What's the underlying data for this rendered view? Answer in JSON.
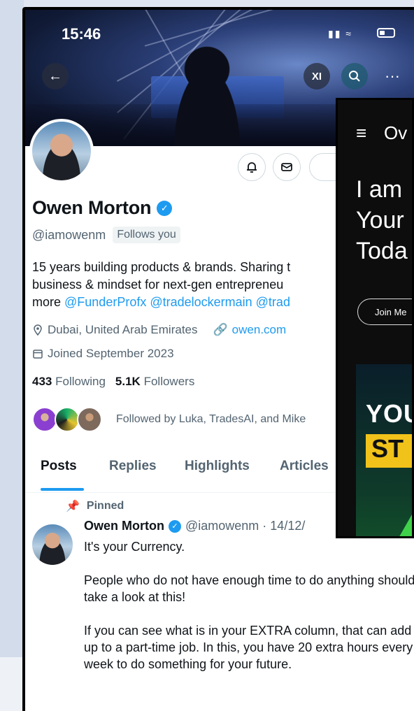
{
  "status_bar": {
    "time": "15:46"
  },
  "header": {
    "back_icon": "arrow-left-icon",
    "grok_label": "XI",
    "search_icon": "search-icon",
    "more_label": "···"
  },
  "profile": {
    "name": "Owen Morton",
    "handle": "@iamowenm",
    "follows_you": "Follows you",
    "bio_line1": "15 years building products & brands. Sharing t",
    "bio_line2": "business & mindset for next-gen entrepreneu",
    "bio_line3_prefix": "more ",
    "bio_mentions": "@FunderProfx @tradelockermain @trad",
    "location": "Dubai, United Arab Emirates",
    "website": "owen.com",
    "joined": "Joined September 2023",
    "following_count": "433",
    "following_label": "Following",
    "followers_count": "5.1K",
    "followers_label": "Followers",
    "followed_by": "Followed by Luka, TradesAI, and Mike"
  },
  "tabs": [
    {
      "label": "Posts",
      "active": true
    },
    {
      "label": "Replies",
      "active": false
    },
    {
      "label": "Highlights",
      "active": false
    },
    {
      "label": "Articles",
      "active": false
    }
  ],
  "post": {
    "pinned_label": "Pinned",
    "author": "Owen Morton",
    "meta": "@iamowenm · 14/12/",
    "para1": "It's your Currency.",
    "para2": "People who do not have enough time to do anything should take a look at this!",
    "para3": "If you can see what is in your EXTRA column, that can add up to a part-time job. In this, you have 20 extra hours every week to do something for your future."
  },
  "ad": {
    "menu_icon": "≡",
    "brand": "Ov",
    "headline_1": "I am",
    "headline_2": "Your",
    "headline_3": "Toda",
    "join_label": "Join Me",
    "media_text_1": "YOU",
    "media_text_2": "ST"
  },
  "colors": {
    "accent": "#1d9bf0",
    "text": "#0f1419",
    "muted": "#536471"
  }
}
